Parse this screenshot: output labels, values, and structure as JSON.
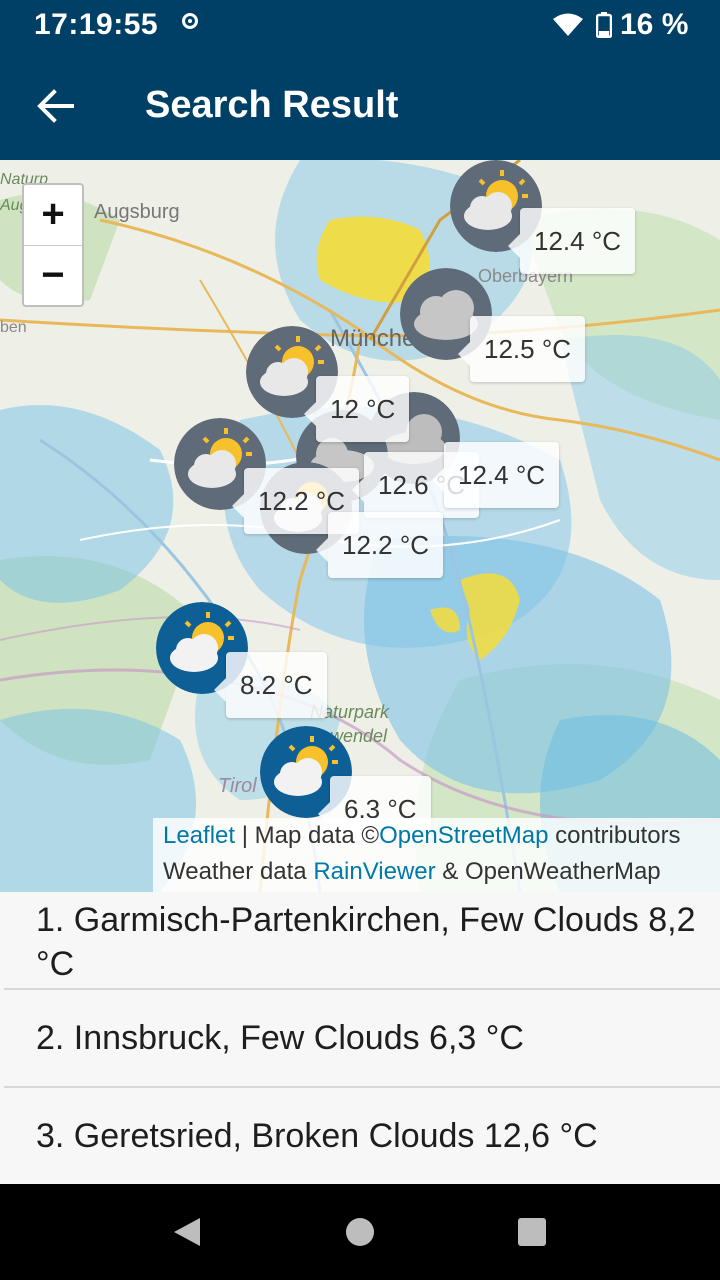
{
  "status": {
    "time": "17:19:55",
    "battery": "16 %"
  },
  "appbar": {
    "title": "Search Result"
  },
  "map": {
    "zoom_in": "+",
    "zoom_out": "−",
    "place_labels": [
      "Augsburg",
      "München",
      "Oberbayern",
      "Naturpark",
      "wendel",
      "Tirol",
      "Naturp",
      "Aug",
      "ben"
    ],
    "markers": [
      {
        "temp": "12.4 °C",
        "icon": "few-clouds-icon"
      },
      {
        "temp": "12.5 °C",
        "icon": "overcast-clouds-icon"
      },
      {
        "temp": "12 °C",
        "icon": "few-clouds-icon"
      },
      {
        "temp": "12.6 °C",
        "icon": "broken-clouds-icon"
      },
      {
        "temp": "12.4 °C",
        "icon": "broken-clouds-icon"
      },
      {
        "temp": "12.2 °C",
        "icon": "few-clouds-icon"
      },
      {
        "temp": "12.2 °C",
        "icon": "few-clouds-icon"
      },
      {
        "temp": "8.2 °C",
        "icon": "few-clouds-icon"
      },
      {
        "temp": "6.3 °C",
        "icon": "few-clouds-icon"
      }
    ],
    "attribution": {
      "leaflet": "Leaflet",
      "sep": " | Map data ©",
      "osm": "OpenStreetMap",
      "contrib": " contributors",
      "weather": "Weather data ",
      "rainviewer": "RainViewer",
      "owm": " & OpenWeatherMap"
    }
  },
  "results": [
    {
      "label": "1. Garmisch-Partenkirchen, Few Clouds 8,2 °C"
    },
    {
      "label": "2. Innsbruck, Few Clouds 6,3 °C"
    },
    {
      "label": "3. Geretsried, Broken Clouds 12,6 °C"
    }
  ],
  "colors": {
    "primary": "#003f66",
    "link": "#0078a8"
  }
}
